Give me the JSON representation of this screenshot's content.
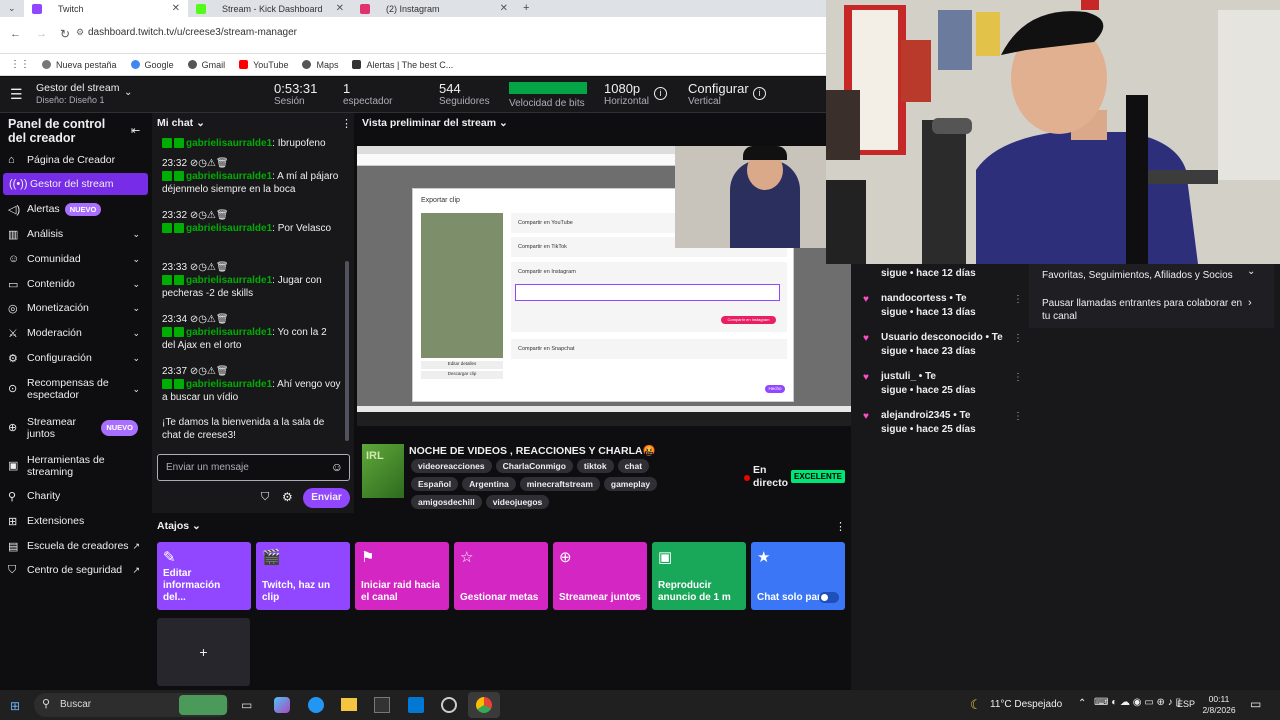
{
  "browser": {
    "tabs": [
      {
        "label": "Twitch",
        "color": "#9146ff"
      },
      {
        "label": "Stream - Kick Dashboard",
        "color": "#53fc18"
      },
      {
        "label": "(2) Instagram",
        "color": "#e1306c"
      }
    ],
    "url": "dashboard.twitch.tv/u/creese3/stream-manager",
    "bookmarks": [
      "Nueva pestaña",
      "Google",
      "Gmail",
      "YouTube",
      "Maps",
      "Alertas | The best C..."
    ]
  },
  "topbar": {
    "menu_title": "Gestor del stream",
    "menu_sub": "Diseño: Diseño 1",
    "session_value": "0:53:31",
    "session_label": "Sesión",
    "viewers_value": "1",
    "viewers_label": "espectador",
    "followers_value": "544",
    "followers_label": "Seguidores",
    "bitrate_label": "Velocidad de bits",
    "resolution_value": "1080p",
    "resolution_label": "Horizontal",
    "configure_value": "Configurar",
    "configure_label": "Vertical"
  },
  "sidebar": {
    "title": "Panel de control del creador",
    "items": [
      {
        "label": "Página de Creador"
      },
      {
        "label": "Gestor del stream"
      },
      {
        "label": "Alertas",
        "badge": "NUEVO"
      },
      {
        "label": "Análisis"
      },
      {
        "label": "Comunidad"
      },
      {
        "label": "Contenido"
      },
      {
        "label": "Monetización"
      },
      {
        "label": "Moderación"
      },
      {
        "label": "Configuración"
      },
      {
        "label": "Recompensas de espectador"
      },
      {
        "label": "Streamear juntos",
        "badge": "NUEVO"
      },
      {
        "label": "Herramientas de streaming"
      },
      {
        "label": "Charity"
      },
      {
        "label": "Extensiones"
      },
      {
        "label": "Escuela de creadores"
      },
      {
        "label": "Centro de seguridad"
      }
    ]
  },
  "chat": {
    "header": "Mi chat",
    "messages": [
      {
        "time": "",
        "user": "gabrielisaurralde1",
        "text": "Ibrupofeno"
      },
      {
        "time": "23:32",
        "user": "gabrielisaurralde1",
        "text": "A mí al pájaro déjenmelo siempre en la boca"
      },
      {
        "time": "23:32",
        "user": "gabrielisaurralde1",
        "text": "Por Velasco"
      },
      {
        "time": "23:33",
        "user": "gabrielisaurralde1",
        "text": "Jugar con pecheras -2 de skills"
      },
      {
        "time": "23:34",
        "user": "gabrielisaurralde1",
        "text": "Yo con la 2 del Ajax en el orto"
      },
      {
        "time": "23:37",
        "user": "gabrielisaurralde1",
        "text": "Ahí vengo voy a buscar un vídio"
      }
    ],
    "welcome": "¡Te damos la bienvenida a la sala de chat de creese3!",
    "input_placeholder": "Enviar un mensaje",
    "send_label": "Enviar"
  },
  "preview": {
    "header": "Vista preliminar del stream",
    "dialog_title": "Exportar clip",
    "share_youtube": "Compartir en YouTube",
    "share_tiktok": "Compartir en TikTok",
    "share_instagram": "Compartir en Instagram",
    "share_snapchat": "Compartir en Snapchat",
    "share_ig_button": "Compartir en Instagram",
    "edit_details": "Editar detalles",
    "download_clip": "Descargar clip",
    "done": "Hecho"
  },
  "stream": {
    "title": "NOCHE DE VIDEOS , REACCIONES Y CHARLA🤬",
    "tags": [
      "videoreacciones",
      "CharlaConmigo",
      "tiktok",
      "chat",
      "Español",
      "Argentina",
      "minecraftstream",
      "gameplay",
      "amigosdechill",
      "videojuegos"
    ],
    "live_label": "En directo",
    "quality": "EXCELENTE",
    "thumb_text": "IRL"
  },
  "shortcuts": {
    "header": "Atajos",
    "cards": [
      {
        "label": "Editar información del...",
        "color": "#9147ff",
        "icon": "✎"
      },
      {
        "label": "Twitch, haz un clip",
        "color": "#9147ff",
        "icon": "🎬"
      },
      {
        "label": "Iniciar raid hacia el canal",
        "color": "#d426c3",
        "icon": "⚑"
      },
      {
        "label": "Gestionar metas",
        "color": "#d426c3",
        "icon": "☆"
      },
      {
        "label": "Streamear juntos",
        "color": "#d426c3",
        "icon": "⊕"
      },
      {
        "label": "Reproducir anuncio de 1 m",
        "color": "#19a85a",
        "icon": "▣"
      },
      {
        "label": "Chat solo para...",
        "color": "#3b76f6",
        "icon": "★"
      }
    ],
    "add": "+"
  },
  "followers": [
    {
      "name": "",
      "text": "sigue • hace 12 días"
    },
    {
      "name": "nandocortess • Te",
      "text": "sigue • hace 13 días"
    },
    {
      "name": "Usuario desconocido • Te",
      "text": "sigue • hace 23 días"
    },
    {
      "name": "justuli_ • Te",
      "text": "sigue • hace 25 días"
    },
    {
      "name": "alejandroi2345 • Te",
      "text": "sigue • hace 25 días"
    }
  ],
  "collab": {
    "line1": "Favoritas, Seguimientos, Afiliados y Socios",
    "line2": "Pausar llamadas entrantes para colaborar en tu canal"
  },
  "taskbar": {
    "search": "Buscar",
    "weather": "11°C  Despejado",
    "lang": "ESP",
    "time": "00:11",
    "date": "2/8/2026"
  }
}
